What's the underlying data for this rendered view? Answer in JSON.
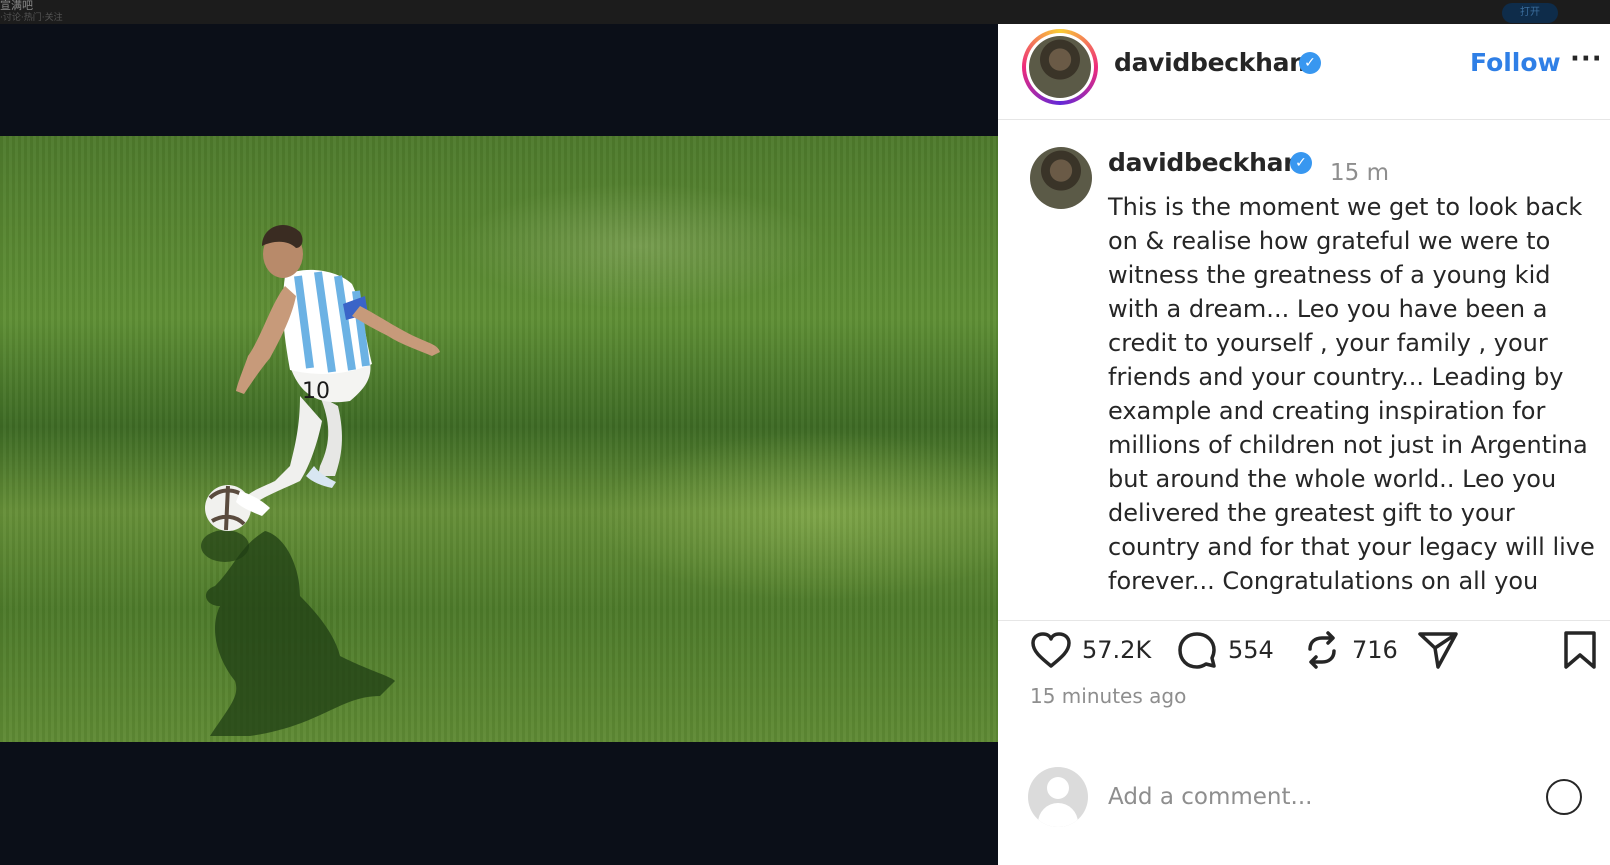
{
  "topbar": {
    "left_text": "宣满吧",
    "left_sub": "·讨论·热门·关注",
    "right_button": "打开"
  },
  "media": {
    "alt": "",
    "shirt_number": "10"
  },
  "post": {
    "username": "davidbeckham",
    "verified": true,
    "follow_label": "Follow",
    "more_label": "···",
    "time_short": "15 m",
    "caption_lines": [
      "This is the moment we get to look back",
      "on & realise how grateful we were to",
      "witness the greatness of a young kid",
      "with a dream... Leo you have been a",
      "credit to yourself , your family , your",
      "friends and your country... Leading by",
      "example and creating inspiration for",
      "millions of children not just in Argentina",
      "but around the whole world.. Leo you",
      "delivered the greatest gift to your",
      "country and for that your legacy will live",
      "forever... Congratulations on all you"
    ],
    "likes": "57.2K",
    "comments": "554",
    "reposts": "716",
    "time_ago": "15 minutes ago",
    "comment_placeholder": "Add a comment..."
  },
  "colors": {
    "accent": "#2f7fe6",
    "verified": "#3897f0",
    "text": "#262626",
    "muted": "#8e8e8e"
  }
}
